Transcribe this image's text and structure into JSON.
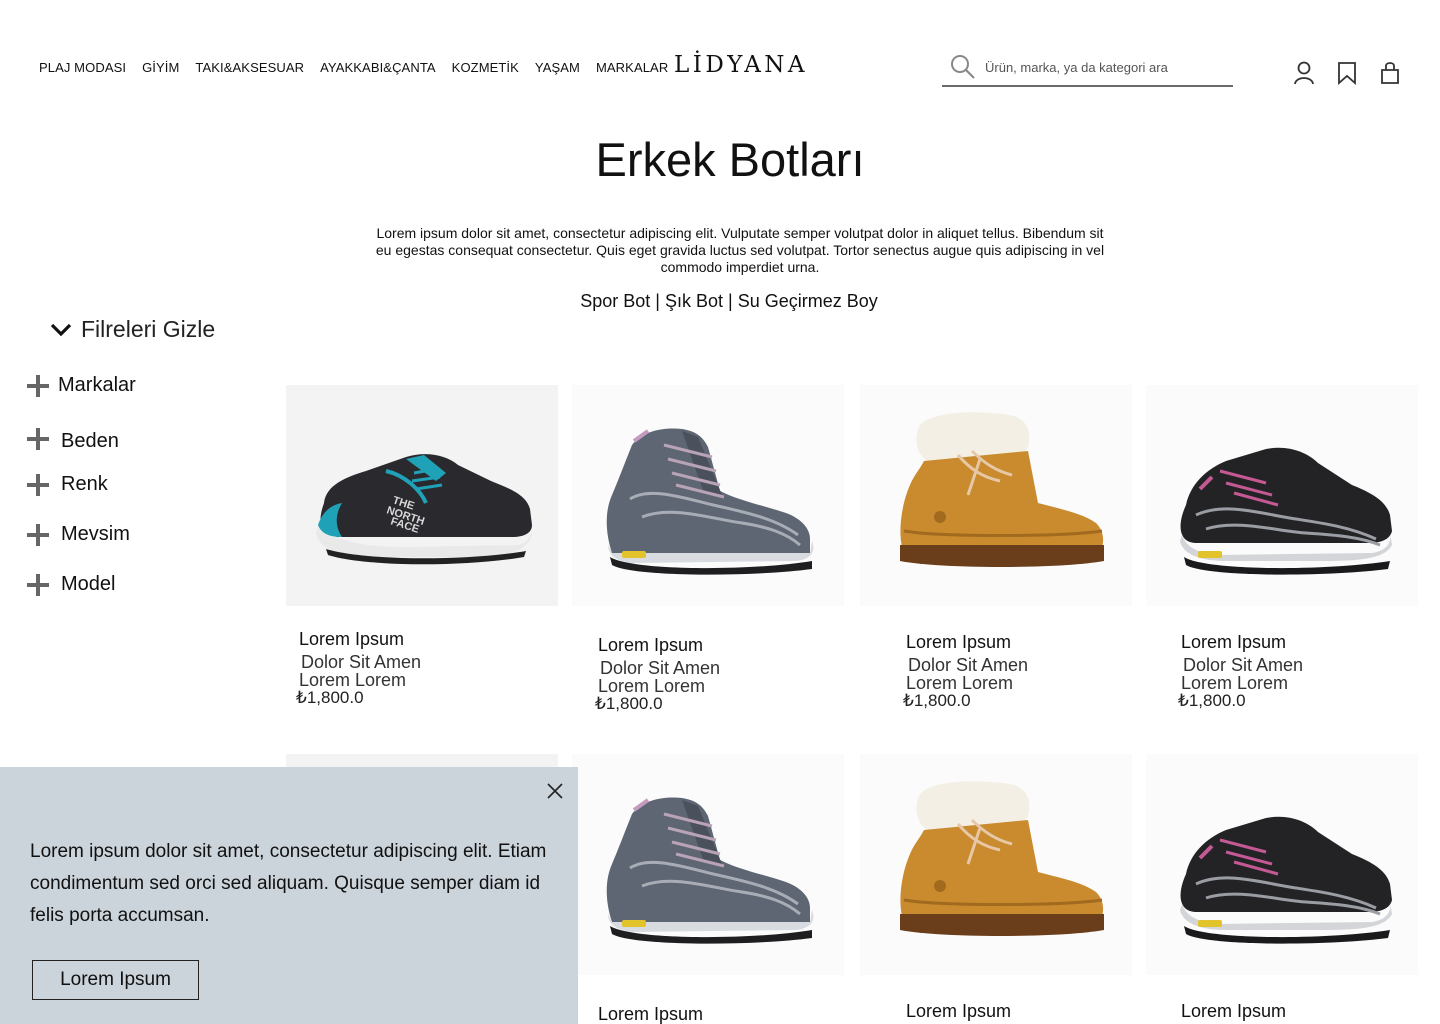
{
  "nav": {
    "items": [
      "PLAJ MODASI",
      "GİYİM",
      "TAKI&AKSESUAR",
      "AYAKKABI&ÇANTA",
      "KOZMETİK",
      "YAŞAM",
      "MARKALAR"
    ]
  },
  "brand": {
    "logo_text": "LİDYANA"
  },
  "search": {
    "placeholder": "Ürün, marka, ya da kategori ara",
    "icon": "search-icon"
  },
  "header_icons": [
    "user-icon",
    "bookmark-icon",
    "shopping-bag-icon"
  ],
  "hero": {
    "title": "Erkek Botları",
    "description": "Lorem ipsum dolor sit amet, consectetur adipiscing elit. Vulputate semper volutpat dolor in aliquet tellus. Bibendum sit eu egestas consequat consectetur. Quis eget gravida luctus sed volutpat. Tortor senectus augue quis adipiscing in vel commodo imperdiet urna.",
    "quick_links": [
      "Spor Bot",
      "Şık Bot",
      "Su Geçirmez Boy"
    ],
    "separator": " | "
  },
  "filters": {
    "toggle_label": "Filreleri Gizle",
    "items": [
      "Markalar",
      "Beden",
      "Renk",
      "Mevsim",
      "Model"
    ]
  },
  "products": [
    {
      "name": "Lorem Ipsum",
      "subtitle": "Dolor Sit Amen",
      "variant": "Lorem Lorem",
      "price": "₺1,800.0",
      "image": "teal-trail-runner"
    },
    {
      "name": "Lorem Ipsum",
      "subtitle": "Dolor Sit Amen",
      "variant": "Lorem Lorem",
      "price": "₺1,800.0",
      "image": "grey-hiking-boot"
    },
    {
      "name": "Lorem Ipsum",
      "subtitle": "Dolor Sit Amen",
      "variant": "Lorem Lorem",
      "price": "₺1,800.0",
      "image": "tan-shearling-boot"
    },
    {
      "name": "Lorem Ipsum",
      "subtitle": "Dolor Sit Amen",
      "variant": "Lorem Lorem",
      "price": "₺1,800.0",
      "image": "black-hiking-shoe"
    },
    {
      "name": "",
      "subtitle": "",
      "variant": "",
      "price": "",
      "image": ""
    },
    {
      "name": "Lorem Ipsum",
      "image": "grey-hiking-boot"
    },
    {
      "name": "Lorem Ipsum",
      "image": "tan-shearling-boot"
    },
    {
      "name": "Lorem Ipsum",
      "image": "black-hiking-shoe"
    }
  ],
  "cookie": {
    "message": "Lorem ipsum dolor sit amet, consectetur adipiscing elit. Etiam condimentum sed orci sed aliquam. Quisque semper diam id felis porta accumsan.",
    "button_label": "Lorem Ipsum",
    "background": "#cbd3db"
  }
}
